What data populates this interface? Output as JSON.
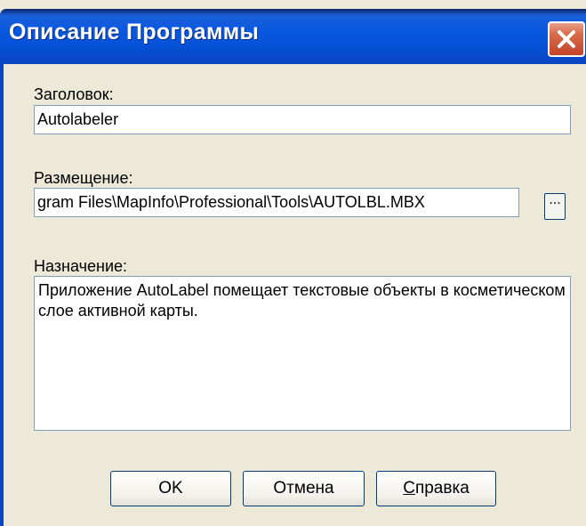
{
  "window": {
    "title": "Описание Программы",
    "close_icon": "close-icon"
  },
  "form": {
    "title_label": "Заголовок:",
    "title_value": "Autolabeler",
    "location_label": "Размещение:",
    "location_value": "gram Files\\MapInfo\\Professional\\Tools\\AUTOLBL.MBX",
    "browse_label": "...",
    "purpose_label": "Назначение:",
    "purpose_value": "Приложение AutoLabel помещает текстовые объекты в косметическом слое активной карты."
  },
  "buttons": {
    "ok": "OK",
    "cancel": "Отмена",
    "help_underlined": "С",
    "help_rest": "правка"
  },
  "colors": {
    "titlebar": "#0a58e0",
    "close": "#d86a4a",
    "dialog_bg": "#ece9d8"
  }
}
